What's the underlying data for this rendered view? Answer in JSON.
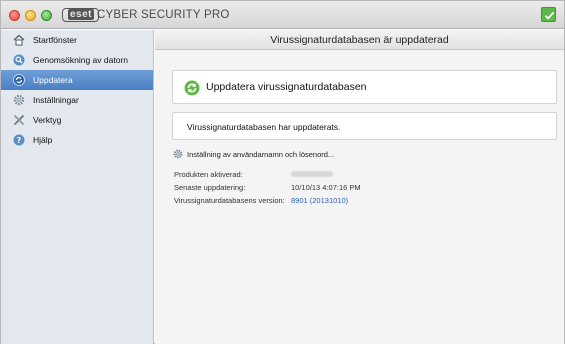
{
  "window": {
    "app_title": "CYBER SECURITY PRO",
    "logo_text": "eset",
    "status": "protected"
  },
  "sidebar": {
    "items": [
      {
        "label": "Startfönster",
        "icon": "home-icon"
      },
      {
        "label": "Genomsökning av datorn",
        "icon": "scan-icon"
      },
      {
        "label": "Uppdatera",
        "icon": "update-icon",
        "active": true
      },
      {
        "label": "Inställningar",
        "icon": "gear-icon"
      },
      {
        "label": "Verktyg",
        "icon": "tools-icon"
      },
      {
        "label": "Hjälp",
        "icon": "help-icon"
      }
    ]
  },
  "main": {
    "header_title": "Virussignaturdatabasen är uppdaterad",
    "update_button_label": "Uppdatera virussignaturdatabasen",
    "status_message": "Virussignaturdatabasen har uppdaterats.",
    "settings_link": "Inställning av användarnamn och lösenord...",
    "info": {
      "activated_label": "Produkten aktiverad:",
      "activated_value": "",
      "last_update_label": "Senaste uppdatering:",
      "last_update_value": "10/10/13 4:07:16 PM",
      "version_label": "Virussignaturdatabasens version:",
      "version_value": "8901 (20131010)"
    }
  },
  "colors": {
    "active_nav": "#4a7fc4",
    "sidebar_bg": "#e3e8ee",
    "status_green": "#5cb848",
    "link_blue": "#2e63b3"
  }
}
